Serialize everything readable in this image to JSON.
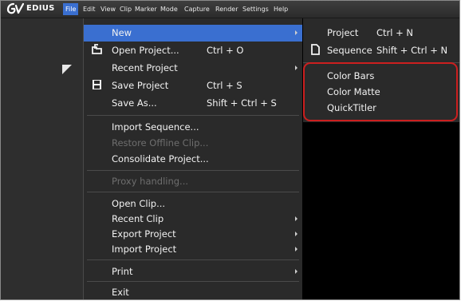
{
  "app": {
    "name": "EDIUS"
  },
  "menubar": {
    "items": [
      "File",
      "Edit",
      "View",
      "Clip",
      "Marker",
      "Mode",
      "Capture",
      "Render",
      "Settings",
      "Help"
    ]
  },
  "file_menu": {
    "items": [
      {
        "label": "New",
        "shortcut": "",
        "submenu": true,
        "disabled": false
      },
      {
        "label": "Open Project...",
        "shortcut": "Ctrl + O",
        "submenu": false,
        "disabled": false,
        "icon": "open-project-icon"
      },
      {
        "label": "Recent Project",
        "shortcut": "",
        "submenu": true,
        "disabled": false
      },
      {
        "label": "Save Project",
        "shortcut": "Ctrl + S",
        "submenu": false,
        "disabled": false,
        "icon": "save-icon"
      },
      {
        "label": "Save As...",
        "shortcut": "Shift + Ctrl + S",
        "submenu": false,
        "disabled": false
      },
      {
        "label": "Import Sequence...",
        "shortcut": "",
        "submenu": false,
        "disabled": false
      },
      {
        "label": "Restore Offline Clip...",
        "shortcut": "",
        "submenu": false,
        "disabled": true
      },
      {
        "label": "Consolidate Project...",
        "shortcut": "",
        "submenu": false,
        "disabled": false
      },
      {
        "label": "Proxy handling...",
        "shortcut": "",
        "submenu": false,
        "disabled": true
      },
      {
        "label": "Open Clip...",
        "shortcut": "",
        "submenu": false,
        "disabled": false
      },
      {
        "label": "Recent Clip",
        "shortcut": "",
        "submenu": true,
        "disabled": false
      },
      {
        "label": "Export Project",
        "shortcut": "",
        "submenu": true,
        "disabled": false
      },
      {
        "label": "Import Project",
        "shortcut": "",
        "submenu": true,
        "disabled": false
      },
      {
        "label": "Print",
        "shortcut": "",
        "submenu": true,
        "disabled": false
      },
      {
        "label": "Exit",
        "shortcut": "",
        "submenu": false,
        "disabled": false
      }
    ]
  },
  "new_submenu": {
    "items": [
      {
        "label": "Project",
        "shortcut": "Ctrl + N"
      },
      {
        "label": "Sequence",
        "shortcut": "Shift + Ctrl + N",
        "icon": "document-icon"
      }
    ],
    "highlighted_group": [
      "Color Bars",
      "Color Matte",
      "QuickTitler"
    ]
  },
  "colors": {
    "highlight": "#3a6fd0",
    "menu_bg": "#2a2a2a",
    "callout": "#cc1f1f"
  }
}
